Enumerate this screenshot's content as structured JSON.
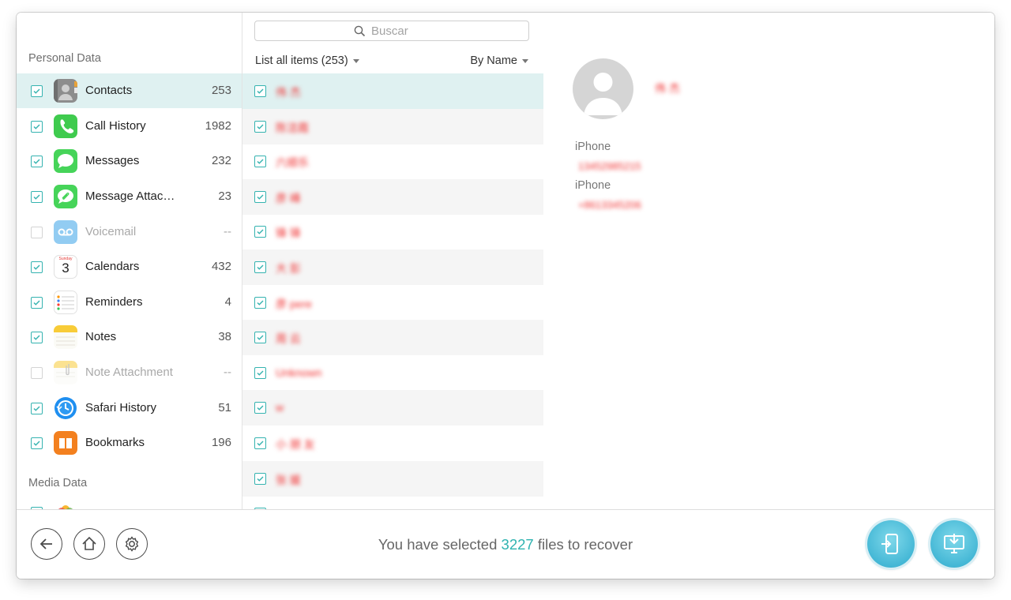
{
  "sidebar": {
    "section_personal": "Personal Data",
    "section_media": "Media Data",
    "items": [
      {
        "label": "Contacts",
        "count": "253",
        "checked": true,
        "icon": "contacts-icon"
      },
      {
        "label": "Call History",
        "count": "1982",
        "checked": true,
        "icon": "phone-icon"
      },
      {
        "label": "Messages",
        "count": "232",
        "checked": true,
        "icon": "messages-icon"
      },
      {
        "label": "Message Attac…",
        "count": "23",
        "checked": true,
        "icon": "paperclip-icon"
      },
      {
        "label": "Voicemail",
        "count": "--",
        "checked": false,
        "icon": "voicemail-icon"
      },
      {
        "label": "Calendars",
        "count": "432",
        "checked": true,
        "icon": "calendar-icon"
      },
      {
        "label": "Reminders",
        "count": "4",
        "checked": true,
        "icon": "reminders-icon"
      },
      {
        "label": "Notes",
        "count": "38",
        "checked": true,
        "icon": "notes-icon"
      },
      {
        "label": "Note Attachment",
        "count": "--",
        "checked": false,
        "icon": "note-attachment-icon"
      },
      {
        "label": "Safari History",
        "count": "51",
        "checked": true,
        "icon": "safari-history-icon"
      },
      {
        "label": "Bookmarks",
        "count": "196",
        "checked": true,
        "icon": "bookmarks-icon"
      }
    ],
    "calendar_day_label": "Sunday",
    "calendar_day_number": "3"
  },
  "list": {
    "search_placeholder": "Buscar",
    "header": "List all items (253)",
    "sort_label": "By Name",
    "items": [
      "伟 杰",
      "陈洁霞",
      "六顺乐",
      "彦 峰",
      "锋 锋",
      "大 彭",
      "彦 pere",
      "周 云",
      "Unknown",
      "w",
      "小 朋 友",
      "张 媛"
    ]
  },
  "detail": {
    "name": "伟 杰",
    "phones": [
      {
        "label": "iPhone",
        "value": "13452985215"
      },
      {
        "label": "iPhone",
        "value": "+8613345206"
      }
    ]
  },
  "footer": {
    "status_prefix": "You have selected ",
    "selected_count": "3227",
    "status_suffix": " files to recover"
  },
  "colors": {
    "accent": "#2eb3b0",
    "selection": "#dff1f1",
    "redacted": "#f03030"
  }
}
